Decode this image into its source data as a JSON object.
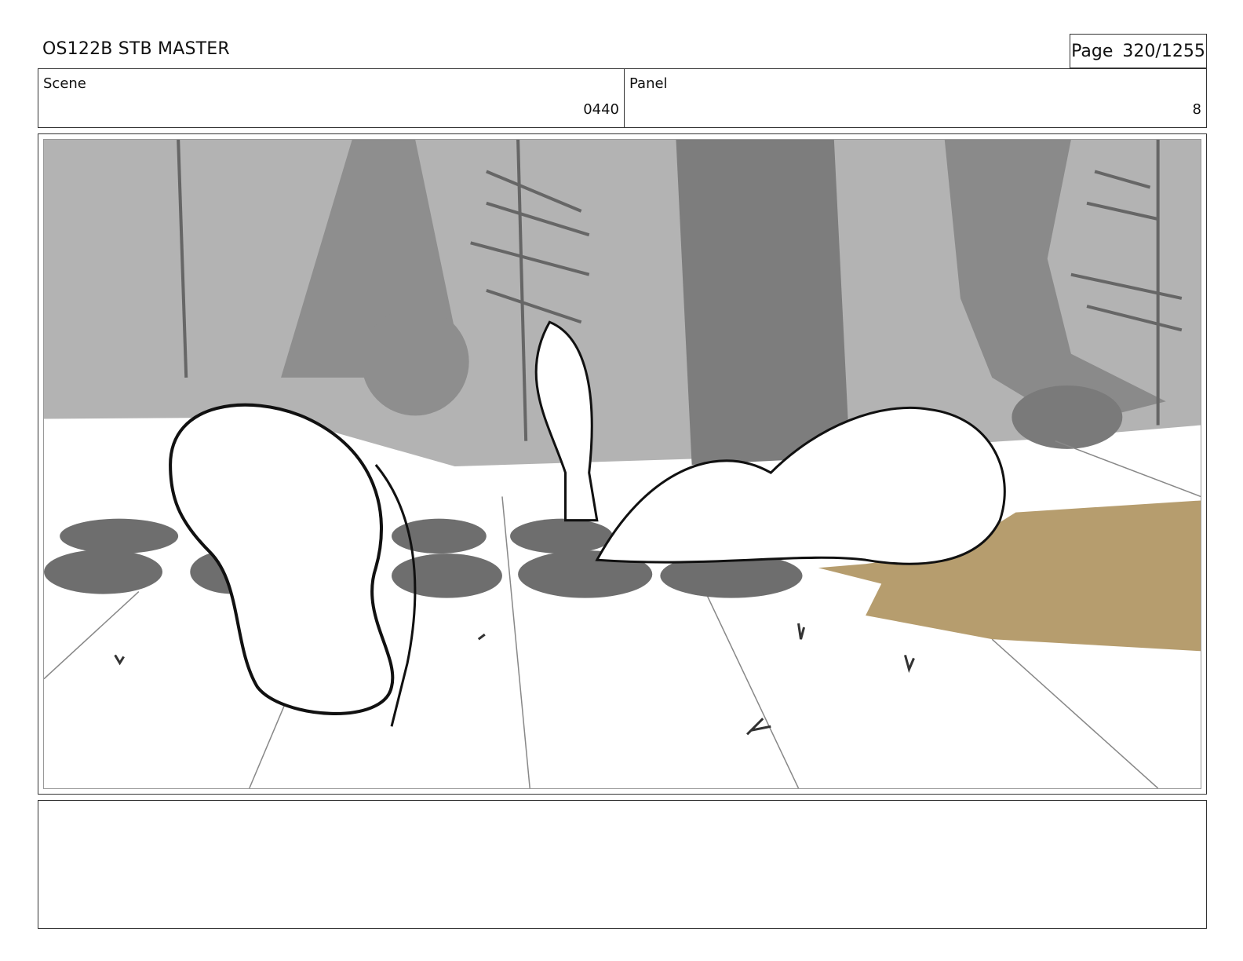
{
  "header": {
    "title": "OS122B STB MASTER",
    "page_label": "Page",
    "page_value": "320/1255"
  },
  "info": {
    "scene_label": "Scene",
    "scene_value": "0440",
    "panel_label": "Panel",
    "panel_value": "8"
  },
  "colors": {
    "background_light": "#b3b3b3",
    "background_dark": "#8a8a8a",
    "tires": "#6e6e6e",
    "puddle": "#b69d6e"
  }
}
